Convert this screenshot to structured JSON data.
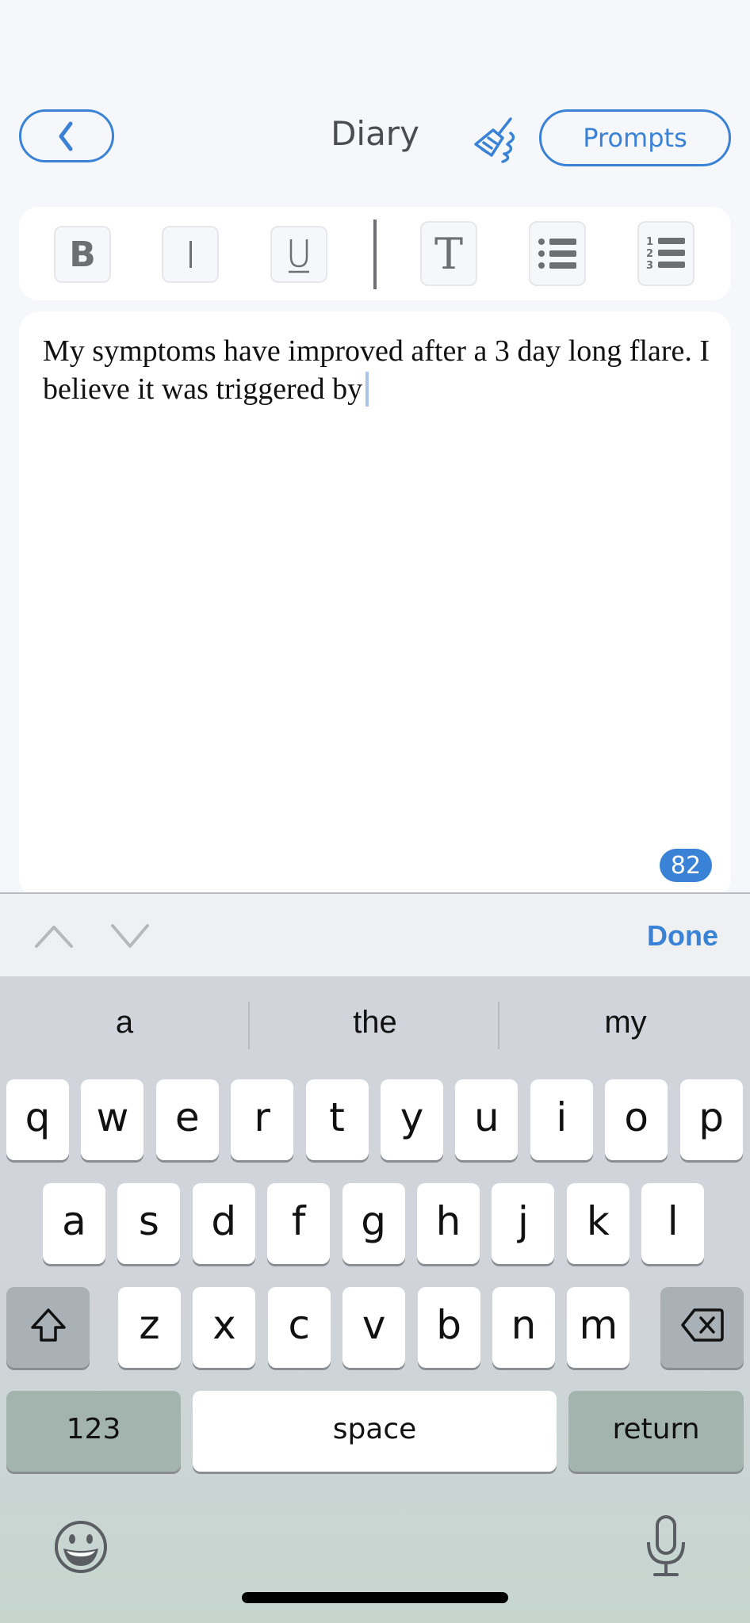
{
  "header": {
    "back_label": "back",
    "title": "Diary",
    "clear_icon": "broom-icon",
    "prompts_label": "Prompts"
  },
  "toolbar": {
    "buttons": [
      {
        "name": "bold",
        "label": "B"
      },
      {
        "name": "italic",
        "label": "I"
      },
      {
        "name": "underline",
        "label": "U"
      },
      {
        "name": "text-style",
        "label": "T"
      },
      {
        "name": "bullet-list",
        "label": "bullet-list"
      },
      {
        "name": "numbered-list",
        "label": "numbered-list"
      }
    ]
  },
  "editor": {
    "text": "My symptoms have improved after a 3 day long flare. I believe it was triggered by",
    "char_count": "82"
  },
  "accessory": {
    "done_label": "Done"
  },
  "keyboard": {
    "suggestions": [
      "a",
      "the",
      "my"
    ],
    "row1": [
      "q",
      "w",
      "e",
      "r",
      "t",
      "y",
      "u",
      "i",
      "o",
      "p"
    ],
    "row2": [
      "a",
      "s",
      "d",
      "f",
      "g",
      "h",
      "j",
      "k",
      "l"
    ],
    "row3": [
      "z",
      "x",
      "c",
      "v",
      "b",
      "n",
      "m"
    ],
    "numbers_label": "123",
    "space_label": "space",
    "return_label": "return"
  },
  "colors": {
    "accent": "#3a82d6",
    "background": "#f6f7fb",
    "keyboard_bg": "#d1d4da"
  }
}
